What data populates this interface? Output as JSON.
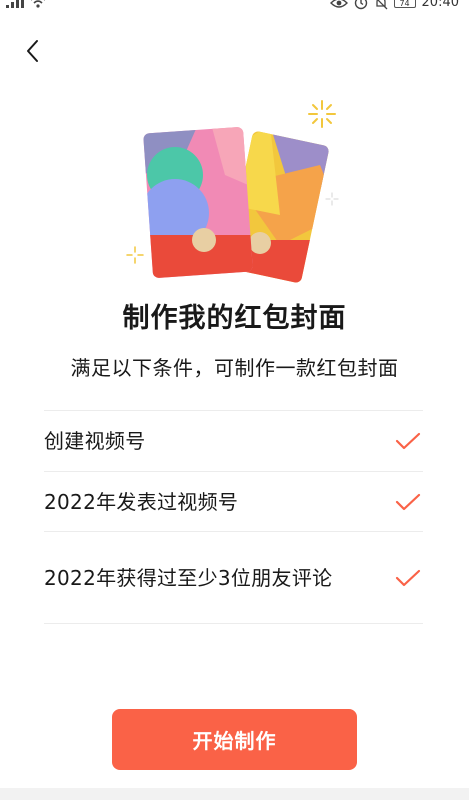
{
  "status_bar": {
    "time": "20:40",
    "battery": "74"
  },
  "title": "制作我的红包封面",
  "subtitle": "满足以下条件，可制作一款红包封面",
  "conditions": [
    {
      "label": "创建视频号",
      "checked": true
    },
    {
      "label": "2022年发表过视频号",
      "checked": true
    },
    {
      "label": "2022年获得过至少3位朋友评论",
      "checked": true
    }
  ],
  "start_button": "开始制作",
  "colors": {
    "accent": "#fa6247",
    "check": "#fa6247",
    "text": "#191919"
  }
}
